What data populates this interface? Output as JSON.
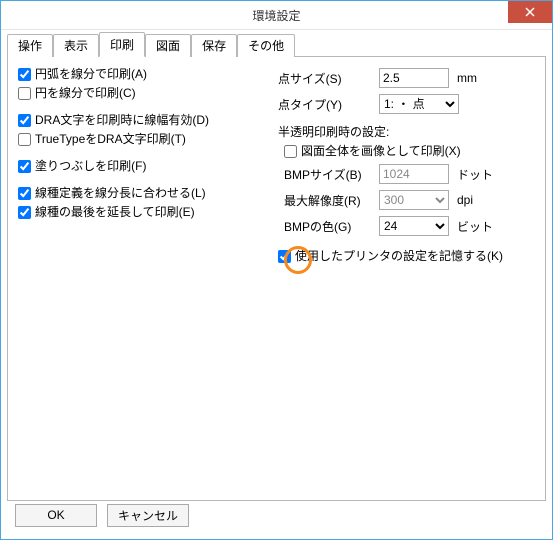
{
  "window": {
    "title": "環境設定"
  },
  "tabs": {
    "items": [
      {
        "label": "操作"
      },
      {
        "label": "表示"
      },
      {
        "label": "印刷"
      },
      {
        "label": "図面"
      },
      {
        "label": "保存"
      },
      {
        "label": "その他"
      }
    ],
    "active_index": 2
  },
  "print": {
    "left": {
      "arc_as_lines": {
        "label": "円弧を線分で印刷(A)",
        "checked": true
      },
      "circle_as_lines": {
        "label": "円を線分で印刷(C)",
        "checked": false
      },
      "dra_linewidth": {
        "label": "DRA文字を印刷時に線幅有効(D)",
        "checked": true
      },
      "truetype_as_dra": {
        "label": "TrueTypeをDRA文字印刷(T)",
        "checked": false
      },
      "fill_print": {
        "label": "塗りつぶしを印刷(F)",
        "checked": true
      },
      "linestyle_fit": {
        "label": "線種定義を線分長に合わせる(L)",
        "checked": true
      },
      "linestyle_extend": {
        "label": "線種の最後を延長して印刷(E)",
        "checked": true
      }
    },
    "right": {
      "point_size": {
        "label": "点サイズ(S)",
        "value": "2.5",
        "unit": "mm"
      },
      "point_type": {
        "label": "点タイプ(Y)",
        "value": "1: ・ 点"
      },
      "semi_header": "半透明印刷時の設定:",
      "print_whole_image": {
        "label": "図面全体を画像として印刷(X)",
        "checked": false
      },
      "bmp_size": {
        "label": "BMPサイズ(B)",
        "value": "1024",
        "unit": "ドット"
      },
      "max_res": {
        "label": "最大解像度(R)",
        "value": "300",
        "unit": "dpi"
      },
      "bmp_color": {
        "label": "BMPの色(G)",
        "value": "24",
        "unit": "ビット"
      },
      "remember_printer": {
        "label": "使用したプリンタの設定を記憶する(K)",
        "checked": true
      }
    }
  },
  "buttons": {
    "ok": "OK",
    "cancel": "キャンセル"
  }
}
